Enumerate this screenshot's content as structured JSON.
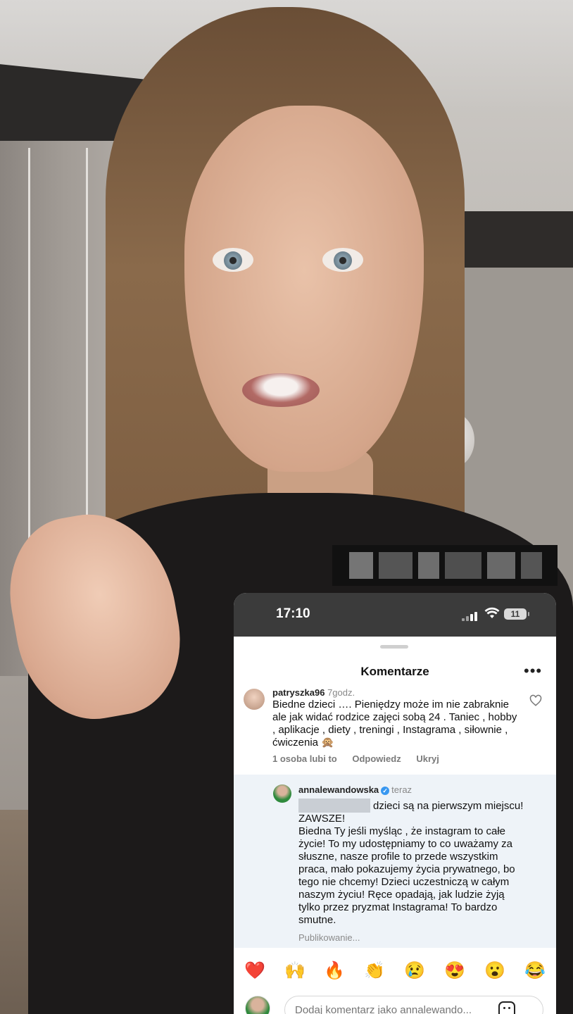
{
  "status_bar": {
    "time": "17:10",
    "battery": "11"
  },
  "sheet": {
    "title": "Komentarze",
    "more_icon": "more-horizontal-icon"
  },
  "comment": {
    "username": "patryszka96",
    "time": "7godz.",
    "text": "Biedne dzieci …. Pieniędzy może im nie zabraknie ale jak widać rodzice zajęci sobą 24 . Taniec , hobby , aplikacje , diety , treningi , Instagrama , siłownie , ćwiczenia 🙊",
    "likes": "1 osoba lubi to",
    "reply": "Odpowiedz",
    "hide": "Ukryj"
  },
  "reply": {
    "username": "annalewandowska",
    "time": "teraz",
    "text": "dzieci są na pierwszym miejscu! ZAWSZE!\nBiedna Ty jeśli myśląc , że instagram to całe życie! To my udostępniamy to co uważamy za słuszne, nasze profile to przede wszystkim praca, mało pokazujemy życia prywatnego, bo tego nie chcemy! Dzieci uczestniczą w całym naszym życiu! Ręce opadają, jak ludzie żyją tylko przez pryzmat Instagrama! To bardzo smutne.",
    "status": "Publikowanie..."
  },
  "emojis": [
    "❤️",
    "🙌",
    "🔥",
    "👏",
    "😢",
    "😍",
    "😮",
    "😂"
  ],
  "composer": {
    "placeholder": "Dodaj komentarz jako annalewando..."
  }
}
